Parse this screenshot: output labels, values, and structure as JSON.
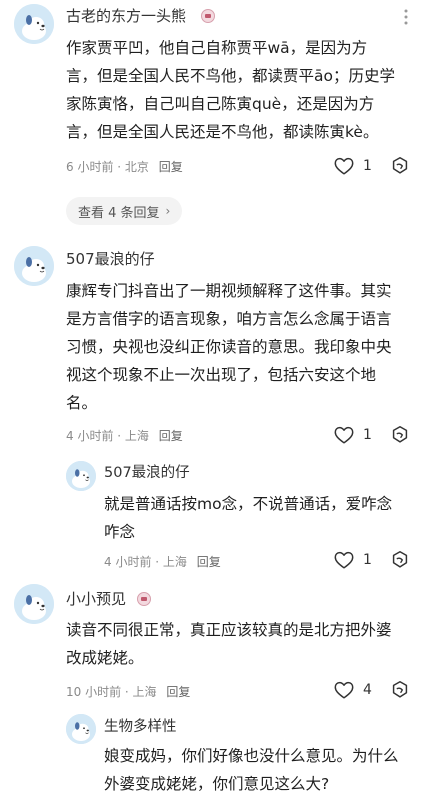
{
  "comments": [
    {
      "user": "古老的东方一头熊",
      "content": "作家贾平凹，他自己自称贾平wā，是因为方言，但是全国人民不鸟他，都读贾平āo；历史学家陈寅恪，自己叫自己陈寅què，还是因为方言，但是全国人民还是不鸟他，都读陈寅kè。",
      "time": "6 小时前",
      "location": "北京",
      "reply": "回复",
      "likes": "1",
      "view_replies": "查看 4 条回复"
    },
    {
      "user": "507最浪的仔",
      "content": "康辉专门抖音出了一期视频解释了这件事。其实是方言借字的语言现象，咱方言怎么念属于语言习惯，央视也没纠正你读音的意思。我印象中央视这个现象不止一次出现了，包括六安这个地名。",
      "time": "4 小时前",
      "location": "上海",
      "reply": "回复",
      "likes": "1"
    },
    {
      "user": "507最浪的仔",
      "content": "就是普通话按mo念，不说普通话，爱咋念咋念",
      "time": "4 小时前",
      "location": "上海",
      "reply": "回复",
      "likes": "1"
    },
    {
      "user": "小小预见",
      "content": "读音不同很正常，真正应该较真的是北方把外婆改成姥姥。",
      "time": "10 小时前",
      "location": "上海",
      "reply": "回复",
      "likes": "4"
    },
    {
      "user": "生物多样性",
      "content": "娘变成妈，你们好像也没什么意见。为什么外婆变成姥姥，你们意见这么大?"
    }
  ],
  "meta_separator": " · ",
  "icons": {
    "like": "heart-icon",
    "share": "share-icon",
    "more": "more-dots-icon",
    "badge": "user-badge-icon",
    "chevron": "chevron-right-icon"
  },
  "colors": {
    "meta": "#8a8a8a",
    "avatar_bg": "#d3e8f6",
    "badge": "#c0596e"
  }
}
